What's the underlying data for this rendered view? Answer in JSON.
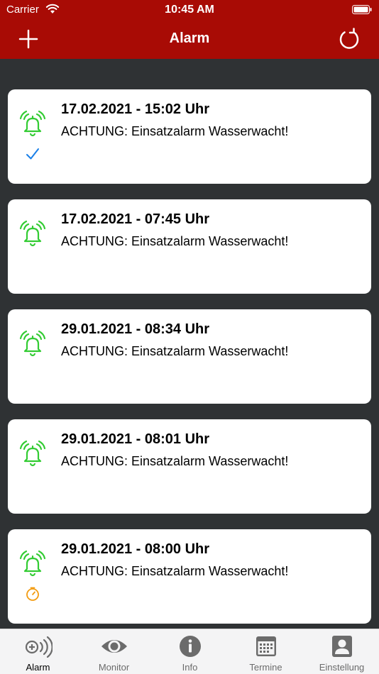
{
  "status_bar": {
    "carrier": "Carrier",
    "time": "10:45 AM"
  },
  "nav": {
    "title": "Alarm"
  },
  "alarms": [
    {
      "date": "17.02.2021 - 15:02 Uhr",
      "message": "ACHTUNG: Einsatzalarm Wasserwacht!",
      "status": "check"
    },
    {
      "date": "17.02.2021 - 07:45 Uhr",
      "message": "ACHTUNG: Einsatzalarm Wasserwacht!",
      "status": "none"
    },
    {
      "date": "29.01.2021 - 08:34 Uhr",
      "message": "ACHTUNG: Einsatzalarm Wasserwacht!",
      "status": "none"
    },
    {
      "date": "29.01.2021 - 08:01 Uhr",
      "message": "ACHTUNG: Einsatzalarm Wasserwacht!",
      "status": "none"
    },
    {
      "date": "29.01.2021 - 08:00 Uhr",
      "message": "ACHTUNG: Einsatzalarm Wasserwacht!",
      "status": "timer"
    }
  ],
  "tabs": [
    {
      "label": "Alarm",
      "icon": "alarm-signal-icon",
      "active": true
    },
    {
      "label": "Monitor",
      "icon": "eye-icon",
      "active": false
    },
    {
      "label": "Info",
      "icon": "info-icon",
      "active": false
    },
    {
      "label": "Termine",
      "icon": "calendar-icon",
      "active": false
    },
    {
      "label": "Einstellung",
      "icon": "person-icon",
      "active": false
    }
  ],
  "colors": {
    "header": "#a80b05",
    "background": "#2f3234",
    "bell": "#33cc33",
    "check": "#1a7fe8",
    "timer": "#f39c12"
  }
}
